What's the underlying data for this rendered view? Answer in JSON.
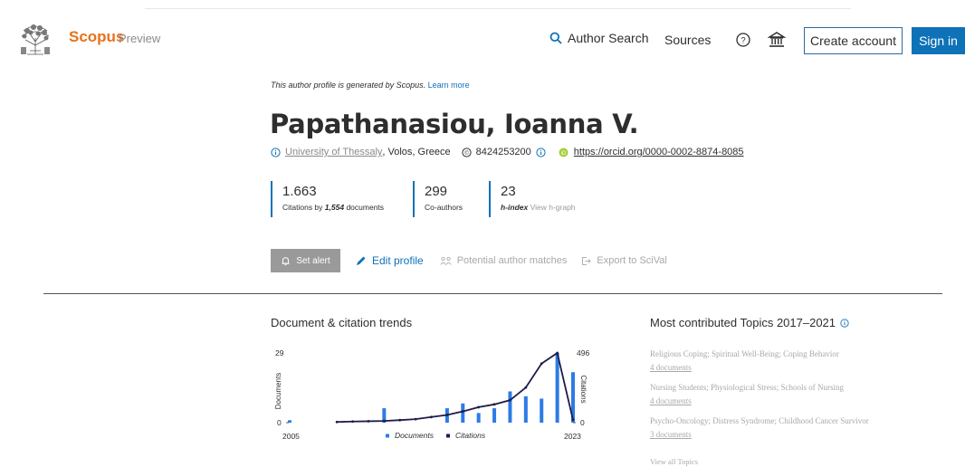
{
  "header": {
    "brand": "Scopus",
    "brand_sub": "Preview",
    "nav": {
      "author_search": "Author Search",
      "sources": "Sources"
    },
    "create_account": "Create account",
    "sign_in": "Sign in",
    "icons": [
      "elsevier-logo",
      "search-icon",
      "help-icon",
      "institution-icon"
    ]
  },
  "profile": {
    "generated_note": "This author profile is generated by Scopus.",
    "learn_more": "Learn more",
    "name": "Papathanasiou, Ioanna V.",
    "affiliation": "University of Thessaly",
    "location": ", Volos, Greece",
    "scopus_id": "8424253200",
    "orcid": "https://orcid.org/0000-0002-8874-8085"
  },
  "metrics": {
    "citations": {
      "value": "1.663",
      "label_prefix": "Citations by",
      "docs": "1,554",
      "label_suffix": "documents"
    },
    "coauthors": {
      "value": "299",
      "label": "Co-authors"
    },
    "hindex": {
      "value": "23",
      "label": "h-index",
      "link": "View h-graph"
    }
  },
  "actions": {
    "set_alert": "Set alert",
    "edit_profile": "Edit profile",
    "potential_matches": "Potential author matches",
    "export": "Export to SciVal"
  },
  "trends": {
    "title": "Document & citation trends"
  },
  "chart_data": {
    "type": "bar",
    "x_start": "2005",
    "x_end": "2023",
    "years": [
      2005,
      2006,
      2007,
      2008,
      2009,
      2010,
      2011,
      2012,
      2013,
      2014,
      2015,
      2016,
      2017,
      2018,
      2019,
      2020,
      2021,
      2022,
      2023
    ],
    "series": [
      {
        "name": "Documents",
        "kind": "bar",
        "color": "#2d7be5",
        "values": [
          1,
          0,
          0,
          0,
          0,
          0,
          6,
          0,
          0,
          0,
          6,
          8,
          4,
          6,
          13,
          11,
          10,
          29,
          21
        ]
      },
      {
        "name": "Citations",
        "kind": "line",
        "color": "#1c1c4a",
        "values": [
          null,
          null,
          null,
          5,
          8,
          10,
          12,
          18,
          25,
          40,
          55,
          80,
          110,
          130,
          160,
          250,
          420,
          496,
          20
        ]
      }
    ],
    "y_left": {
      "label": "Documents",
      "max_label": "29",
      "min_label": "0",
      "ylim": [
        0,
        29
      ]
    },
    "y_right": {
      "label": "Citations",
      "max_label": "496",
      "min_label": "0",
      "ylim": [
        0,
        496
      ]
    }
  },
  "topics": {
    "title": "Most contributed Topics 2017–2021",
    "items": [
      {
        "name": "Religious Coping; Spiritual Well-Being; Coping Behavior",
        "docs": "4 documents"
      },
      {
        "name": "Nursing Students; Physiological Stress; Schools of Nursing",
        "docs": "4 documents"
      },
      {
        "name": "Psycho-Oncology; Distress Syndrome; Childhood Cancer Survivor",
        "docs": "3 documents"
      }
    ],
    "view_all": "View all Topics"
  }
}
